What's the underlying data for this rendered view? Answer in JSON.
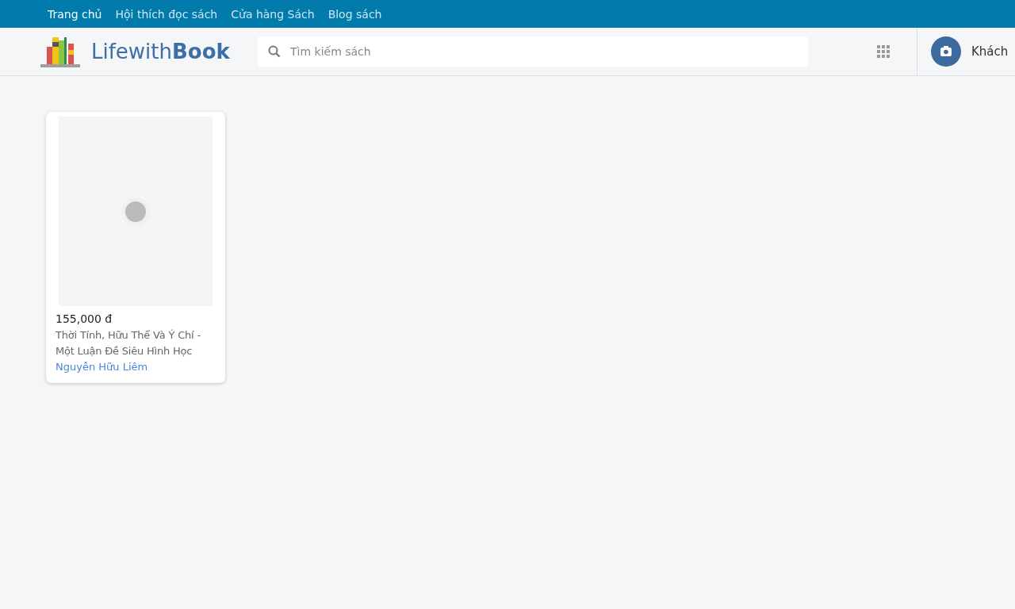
{
  "top_nav": [
    {
      "label": "Trang chủ",
      "selected": true
    },
    {
      "label": "Hội thích đọc sách",
      "selected": false
    },
    {
      "label": "Cửa hàng Sách",
      "selected": false
    },
    {
      "label": "Blog sách",
      "selected": false
    }
  ],
  "header": {
    "logo": {
      "light": "Lifewith",
      "bold": "Book"
    },
    "search": {
      "placeholder": "Tìm kiếm sách"
    },
    "user": {
      "name": "Khách"
    }
  },
  "books": [
    {
      "price": "155,000 đ",
      "title": "Thời Tính, Hữu Thể Và Ý Chí - Một Luận Đề Siêu Hình Học",
      "author": "Nguyễn Hữu Liêm"
    }
  ]
}
